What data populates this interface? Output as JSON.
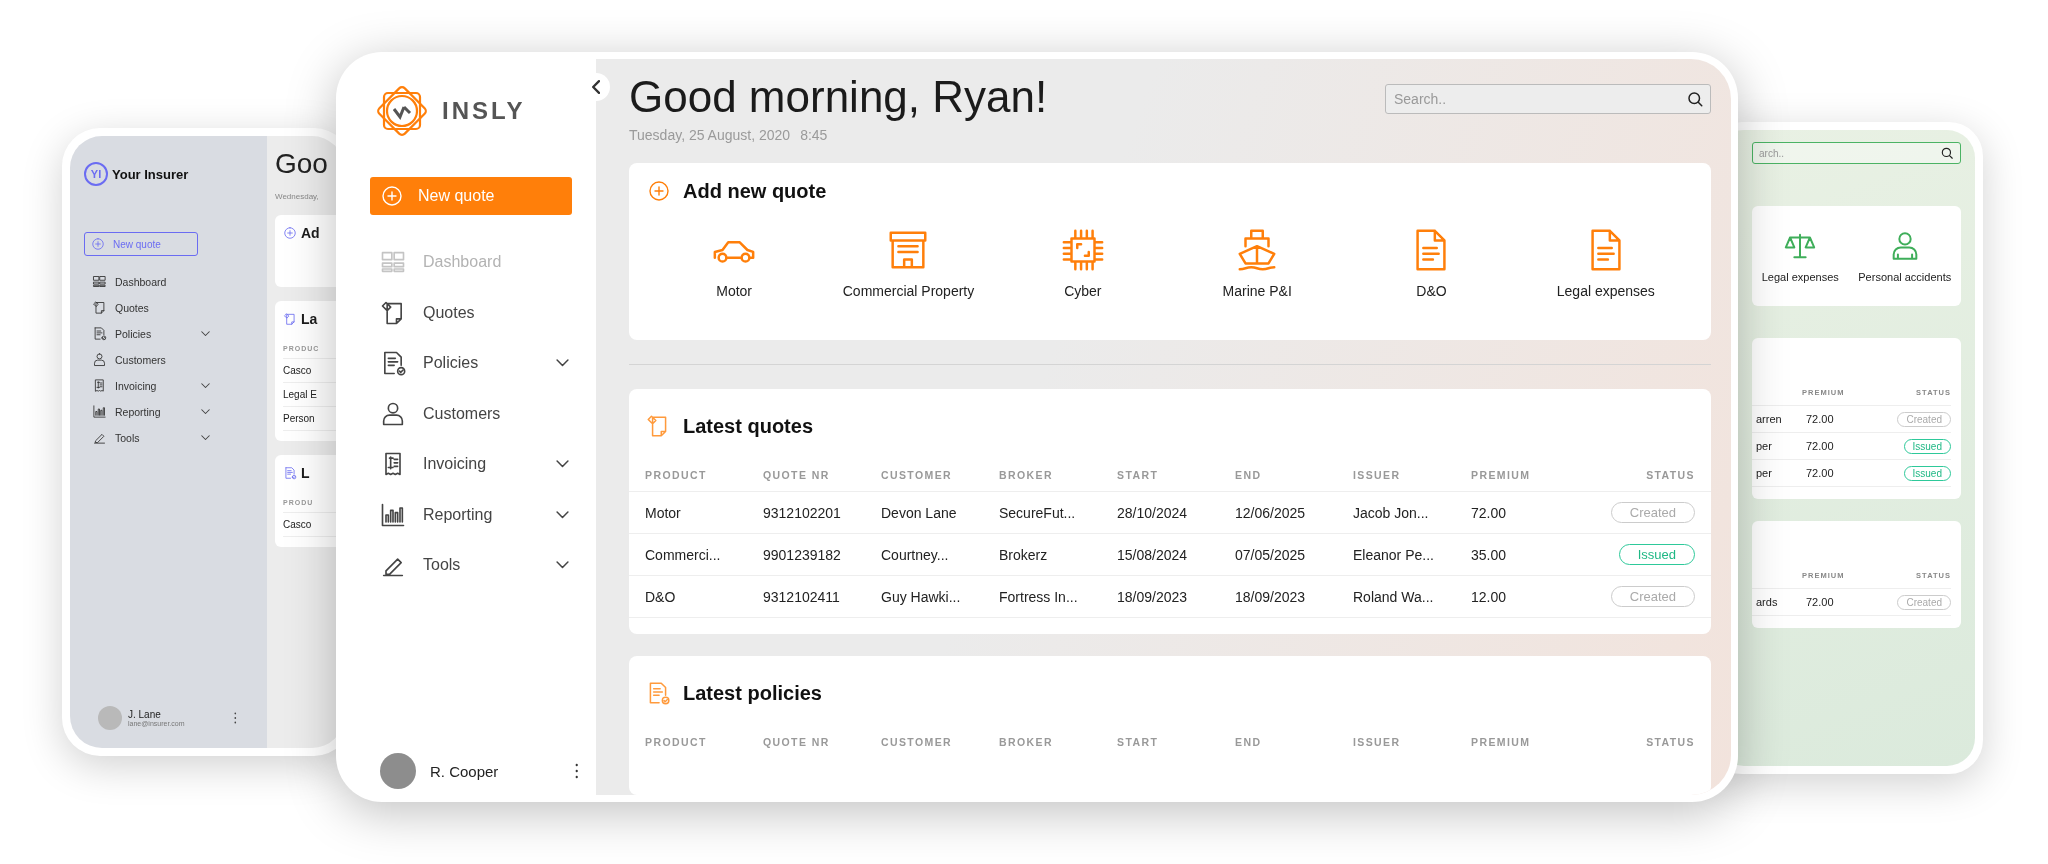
{
  "left_tablet": {
    "brand_mark": "YI",
    "brand": "Your Insurer",
    "new_quote_button": "New quote",
    "nav": [
      {
        "label": "Dashboard",
        "expandable": false
      },
      {
        "label": "Quotes",
        "expandable": false
      },
      {
        "label": "Policies",
        "expandable": true
      },
      {
        "label": "Customers",
        "expandable": false
      },
      {
        "label": "Invoicing",
        "expandable": true
      },
      {
        "label": "Reporting",
        "expandable": true
      },
      {
        "label": "Tools",
        "expandable": true
      }
    ],
    "user": {
      "name": "J. Lane",
      "email": "lane@insurer.com"
    },
    "greeting": "Goo",
    "date": "Wednesday,",
    "cards": [
      {
        "title": "Ad"
      },
      {
        "title": "La",
        "column": "PRODUC",
        "rows": [
          "Casco",
          "Legal E",
          "Person"
        ]
      },
      {
        "title": "L",
        "column": "PRODU",
        "rows": [
          "Casco"
        ]
      }
    ]
  },
  "main_tablet": {
    "sidebar": {
      "brand": "INSLY",
      "new_quote_button": "New quote",
      "nav": [
        {
          "label": "Dashboard",
          "selected": true,
          "expandable": false
        },
        {
          "label": "Quotes",
          "selected": false,
          "expandable": false
        },
        {
          "label": "Policies",
          "selected": false,
          "expandable": true
        },
        {
          "label": "Customers",
          "selected": false,
          "expandable": false
        },
        {
          "label": "Invoicing",
          "selected": false,
          "expandable": true
        },
        {
          "label": "Reporting",
          "selected": false,
          "expandable": true
        },
        {
          "label": "Tools",
          "selected": false,
          "expandable": true
        }
      ],
      "user": {
        "name": "R. Cooper"
      }
    },
    "header": {
      "greeting": "Good morning, Ryan!",
      "date": "Tuesday, 25 August, 2020",
      "time": "8:45",
      "search": {
        "placeholder": "Search.."
      }
    },
    "add_new_quote": {
      "title": "Add new quote",
      "products": [
        {
          "label": "Motor",
          "kind": "car"
        },
        {
          "label": "Commercial Property",
          "kind": "building"
        },
        {
          "label": "Cyber",
          "kind": "chip"
        },
        {
          "label": "Marine P&I",
          "kind": "ship"
        },
        {
          "label": "D&O",
          "kind": "document"
        },
        {
          "label": "Legal expenses",
          "kind": "document"
        }
      ]
    },
    "latest_quotes": {
      "title": "Latest quotes",
      "columns": [
        "PRODUCT",
        "QUOTE NR",
        "CUSTOMER",
        "BROKER",
        "START",
        "END",
        "ISSUER",
        "PREMIUM",
        "STATUS"
      ],
      "rows": [
        {
          "cells": [
            "Motor",
            "9312102201",
            "Devon Lane",
            "SecureFut...",
            "28/10/2024",
            "12/06/2025",
            "Jacob Jon...",
            "72.00"
          ],
          "status": {
            "label": "Created",
            "kind": "created"
          }
        },
        {
          "cells": [
            "Commerci...",
            "9901239182",
            "Courtney...",
            "Brokerz",
            "15/08/2024",
            "07/05/2025",
            "Eleanor Pe...",
            "35.00"
          ],
          "status": {
            "label": "Issued",
            "kind": "issued"
          }
        },
        {
          "cells": [
            "D&O",
            "9312102411",
            "Guy Hawki...",
            "Fortress In...",
            "18/09/2023",
            "18/09/2023",
            "Roland Wa...",
            "12.00"
          ],
          "status": {
            "label": "Created",
            "kind": "created"
          }
        }
      ]
    },
    "latest_policies": {
      "title": "Latest policies",
      "columns": [
        "PRODUCT",
        "QUOTE NR",
        "CUSTOMER",
        "BROKER",
        "START",
        "END",
        "ISSUER",
        "PREMIUM",
        "STATUS"
      ]
    }
  },
  "right_tablet": {
    "search": {
      "placeholder": "arch.."
    },
    "products": [
      {
        "label": "Legal expenses",
        "kind": "scales"
      },
      {
        "label": "Personal accidents",
        "kind": "person"
      }
    ],
    "tables": [
      {
        "columns": [
          "PREMIUM",
          "STATUS"
        ],
        "rows": [
          {
            "customer": "arren",
            "premium": "72.00",
            "status": {
              "label": "Created",
              "kind": "created"
            }
          },
          {
            "customer": "per",
            "premium": "72.00",
            "status": {
              "label": "Issued",
              "kind": "issued"
            }
          },
          {
            "customer": "per",
            "premium": "72.00",
            "status": {
              "label": "Issued",
              "kind": "issued"
            }
          }
        ]
      },
      {
        "columns": [
          "PREMIUM",
          "STATUS"
        ],
        "rows": [
          {
            "customer": "ards",
            "premium": "72.00",
            "status": {
              "label": "Created",
              "kind": "created"
            }
          }
        ]
      }
    ]
  }
}
